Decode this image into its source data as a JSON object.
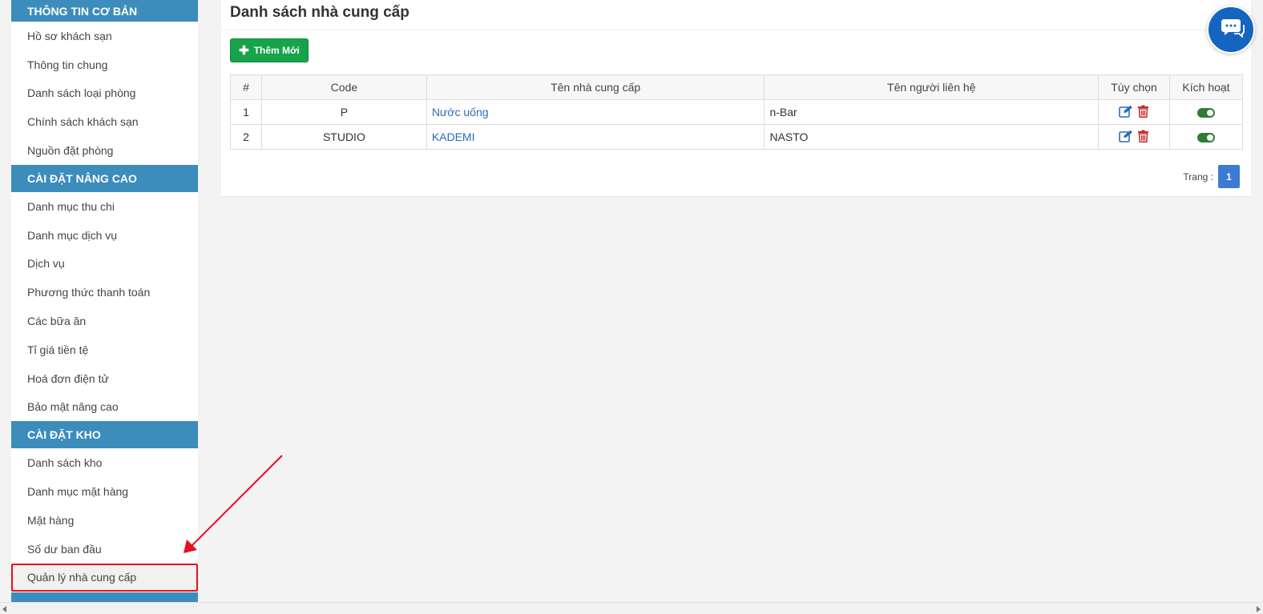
{
  "sidebar": {
    "sections": [
      {
        "title": "THÔNG TIN CƠ BẢN",
        "items": [
          "Hồ sơ khách sạn",
          "Thông tin chung",
          "Danh sách loại phòng",
          "Chính sách khách sạn",
          "Nguồn đặt phòng"
        ]
      },
      {
        "title": "CÀI ĐẶT NÂNG CAO",
        "items": [
          "Danh mục thu chi",
          "Danh mục dịch vụ",
          "Dịch vụ",
          "Phương thức thanh toán",
          "Các bữa ăn",
          "Tỉ giá tiền tệ",
          "Hoá đơn điện tử",
          "Bảo mật nâng cao"
        ]
      },
      {
        "title": "CÀI ĐẶT KHO",
        "items": [
          "Danh sách kho",
          "Danh mục mặt hàng",
          "Mặt hàng",
          "Số dư ban đầu",
          "Quản lý nhà cung cấp"
        ]
      }
    ],
    "active_item": "Quản lý nhà cung cấp"
  },
  "page": {
    "title": "Danh sách nhà cung cấp",
    "add_button": "Thêm Mới"
  },
  "table": {
    "headers": {
      "num": "#",
      "code": "Code",
      "name": "Tên nhà cung cấp",
      "contact": "Tên người liên hệ",
      "options": "Tùy chọn",
      "active": "Kích hoạt"
    },
    "rows": [
      {
        "num": "1",
        "code": "P",
        "name": "Nước uống",
        "contact": "n-Bar",
        "active": true
      },
      {
        "num": "2",
        "code": "STUDIO",
        "name": "KADEMI",
        "contact": "NASTO",
        "active": true
      }
    ]
  },
  "pager": {
    "label": "Trang :",
    "current": "1"
  },
  "colors": {
    "header_blue": "#3c8dbc",
    "add_green": "#16a34a",
    "link_blue": "#2a6cb5",
    "delete_red": "#c62828",
    "toggle_green": "#2e7d32",
    "highlight_red": "#e3101f",
    "chat_blue": "#1565c0"
  },
  "icons": {
    "add": "plus-icon",
    "edit": "edit-icon",
    "delete": "trash-icon",
    "chat": "chat-icon"
  }
}
